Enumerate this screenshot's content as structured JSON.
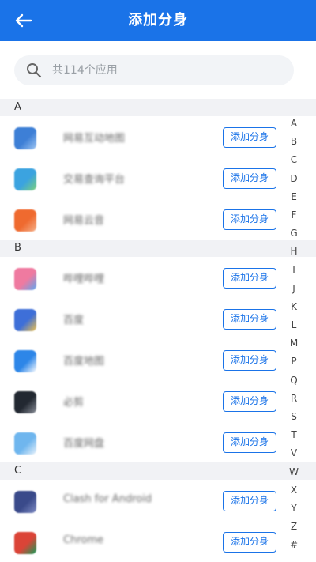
{
  "header": {
    "title": "添加分身"
  },
  "search": {
    "placeholder": "共114个应用"
  },
  "add_label": "添加分身",
  "sections": [
    {
      "letter": "A",
      "apps": [
        {
          "name": "网易互动地图",
          "color": "#3d7fd6",
          "accent": "#9ec5f3"
        },
        {
          "name": "交易查询平台",
          "color": "#3ba3e0",
          "accent": "#7bd17a"
        },
        {
          "name": "网易云音",
          "color": "#ef6a2f",
          "accent": "#f5b08a"
        }
      ]
    },
    {
      "letter": "B",
      "apps": [
        {
          "name": "哔哩哔哩",
          "color": "#ef7aa0",
          "accent": "#5aa7f2"
        },
        {
          "name": "百度",
          "color": "#3e6fd8",
          "accent": "#f2c34a"
        },
        {
          "name": "百度地图",
          "color": "#2d86e8",
          "accent": "#ffffff"
        },
        {
          "name": "必剪",
          "color": "#222831",
          "accent": "#8a8f99"
        },
        {
          "name": "百度网盘",
          "color": "#6fb6ee",
          "accent": "#e8f2fb"
        }
      ]
    },
    {
      "letter": "C",
      "apps": [
        {
          "name": "Clash for Android",
          "color": "#3a4a8a",
          "accent": "#7f8cc4"
        },
        {
          "name": "Chrome",
          "color": "#db4437",
          "accent": "#0f9d58"
        }
      ]
    }
  ],
  "alphabet": [
    "A",
    "B",
    "C",
    "D",
    "E",
    "F",
    "G",
    "H",
    "I",
    "J",
    "K",
    "L",
    "M",
    "P",
    "Q",
    "R",
    "S",
    "T",
    "V",
    "W",
    "X",
    "Y",
    "Z",
    "#"
  ]
}
